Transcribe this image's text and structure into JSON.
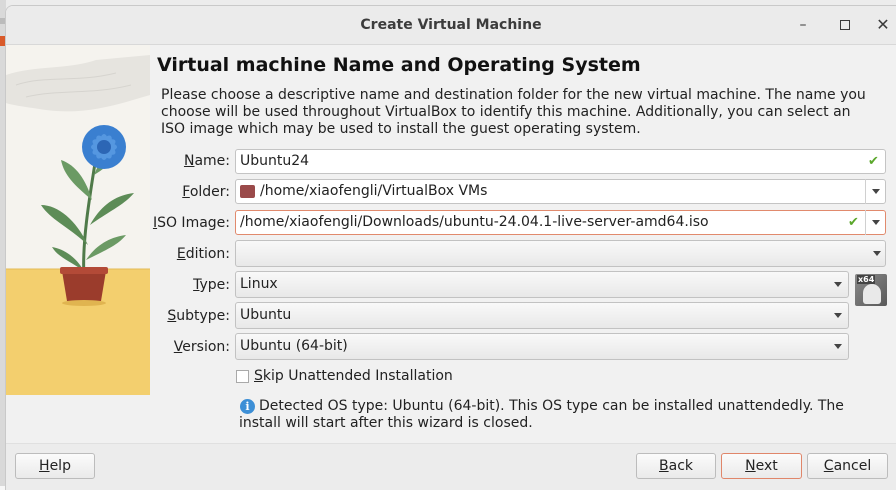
{
  "window": {
    "title": "Create Virtual Machine",
    "controls": {
      "minimize": "–",
      "close": "✕"
    }
  },
  "page": {
    "heading": "Virtual machine Name and Operating System",
    "description": "Please choose a descriptive name and destination folder for the new virtual machine. The name you choose will be used throughout VirtualBox to identify this machine. Additionally, you can select an ISO image which may be used to install the guest operating system."
  },
  "form": {
    "name": {
      "label_u": "N",
      "label_rest": "ame:",
      "value": "Ubuntu24"
    },
    "folder": {
      "label_u": "F",
      "label_rest": "older:",
      "value": "/home/xiaofengli/VirtualBox VMs"
    },
    "iso": {
      "label_u": "I",
      "label_rest": "SO Image:",
      "value": "/home/xiaofengli/Downloads/ubuntu-24.04.1-live-server-amd64.iso"
    },
    "edition": {
      "label_u": "E",
      "label_rest": "dition:",
      "value": ""
    },
    "type": {
      "label_pre": "",
      "label_u": "T",
      "label_rest": "ype:",
      "value": "Linux"
    },
    "subtype": {
      "label_pre": "",
      "label_u": "S",
      "label_rest": "ubtype:",
      "value": "Ubuntu"
    },
    "version": {
      "label_pre": "",
      "label_u": "V",
      "label_rest": "ersion:",
      "value": "Ubuntu (64-bit)"
    },
    "os_icon_tag": "x64"
  },
  "skip_unattended": {
    "label_u": "S",
    "label_rest": "kip Unattended Installation",
    "checked": false
  },
  "info": {
    "icon": "i",
    "text": "Detected OS type: Ubuntu (64-bit). This OS type can be installed unattendedly. The install will start after this wizard is closed."
  },
  "buttons": {
    "help": {
      "u": "H",
      "rest": "elp"
    },
    "back": {
      "u": "B",
      "rest": "ack"
    },
    "next": {
      "u": "N",
      "rest": "ext"
    },
    "cancel": {
      "u": "C",
      "rest": "ancel"
    }
  },
  "icons": {
    "valid": "check-icon",
    "folder": "folder-icon",
    "dropdown": "chevron-down-icon",
    "info": "info-icon",
    "os": "linux-os-icon"
  },
  "colors": {
    "accent_border": "#e18a6d",
    "valid_check": "#5aa72b",
    "info_blue": "#3d8fd6",
    "flower_blue": "#3a7fd0"
  }
}
